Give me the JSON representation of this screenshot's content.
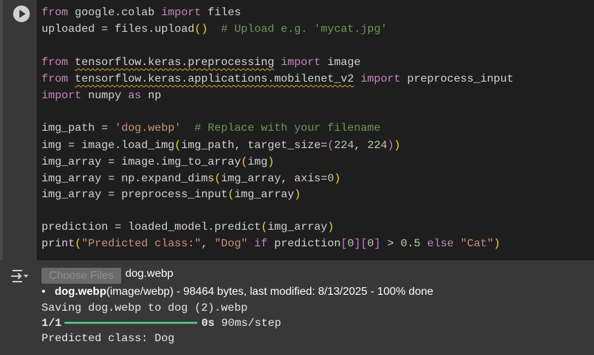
{
  "cell": {
    "run_button": "play-icon",
    "code_lines": [
      [
        [
          "kw",
          "from"
        ],
        [
          "id",
          " google.colab "
        ],
        [
          "kw",
          "import"
        ],
        [
          "id",
          " files"
        ]
      ],
      [
        [
          "id",
          "uploaded = files.upload"
        ],
        [
          "p1",
          "()"
        ],
        [
          "id",
          "  "
        ],
        [
          "cm",
          "# Upload e.g. 'mycat.jpg'"
        ]
      ],
      [],
      [
        [
          "kw",
          "from"
        ],
        [
          "id",
          " "
        ],
        [
          "sq",
          "tensorflow.keras.preprocessing"
        ],
        [
          "id",
          " "
        ],
        [
          "kw",
          "import"
        ],
        [
          "id",
          " image"
        ]
      ],
      [
        [
          "kw",
          "from"
        ],
        [
          "id",
          " "
        ],
        [
          "sq",
          "tensorflow.keras.applications.mobilenet_v2"
        ],
        [
          "id",
          " "
        ],
        [
          "kw",
          "import"
        ],
        [
          "id",
          " preprocess_input"
        ]
      ],
      [
        [
          "kw",
          "import"
        ],
        [
          "id",
          " numpy "
        ],
        [
          "kw",
          "as"
        ],
        [
          "id",
          " np"
        ]
      ],
      [],
      [
        [
          "id",
          "img_path = "
        ],
        [
          "st",
          "'dog.webp'"
        ],
        [
          "id",
          "  "
        ],
        [
          "cm",
          "# Replace with your filename"
        ]
      ],
      [
        [
          "id",
          "img = image.load_img"
        ],
        [
          "p1",
          "("
        ],
        [
          "id",
          "img_path, target_size="
        ],
        [
          "p2",
          "("
        ],
        [
          "nm",
          "224"
        ],
        [
          "id",
          ", "
        ],
        [
          "nm",
          "224"
        ],
        [
          "p2",
          ")"
        ],
        [
          "p1",
          ")"
        ]
      ],
      [
        [
          "id",
          "img_array = image.img_to_array"
        ],
        [
          "p1",
          "("
        ],
        [
          "id",
          "img"
        ],
        [
          "p1",
          ")"
        ]
      ],
      [
        [
          "id",
          "img_array = np.expand_dims"
        ],
        [
          "p1",
          "("
        ],
        [
          "id",
          "img_array, axis="
        ],
        [
          "nm",
          "0"
        ],
        [
          "p1",
          ")"
        ]
      ],
      [
        [
          "id",
          "img_array = preprocess_input"
        ],
        [
          "p1",
          "("
        ],
        [
          "id",
          "img_array"
        ],
        [
          "p1",
          ")"
        ]
      ],
      [],
      [
        [
          "id",
          "prediction = loaded_model.predict"
        ],
        [
          "p1",
          "("
        ],
        [
          "id",
          "img_array"
        ],
        [
          "p1",
          ")"
        ]
      ],
      [
        [
          "id",
          "print"
        ],
        [
          "p1",
          "("
        ],
        [
          "st",
          "\"Predicted class:\""
        ],
        [
          "id",
          ", "
        ],
        [
          "st",
          "\"Dog\""
        ],
        [
          "id",
          " "
        ],
        [
          "kw",
          "if"
        ],
        [
          "id",
          " prediction"
        ],
        [
          "p2",
          "["
        ],
        [
          "nm",
          "0"
        ],
        [
          "p2",
          "]["
        ],
        [
          "nm",
          "0"
        ],
        [
          "p2",
          "]"
        ],
        [
          "id",
          " > "
        ],
        [
          "nm",
          "0.5"
        ],
        [
          "id",
          " "
        ],
        [
          "kw",
          "else"
        ],
        [
          "id",
          " "
        ],
        [
          "st",
          "\"Cat\""
        ],
        [
          "p1",
          ")"
        ]
      ]
    ]
  },
  "output": {
    "icon": "output-toggle-icon",
    "choose_files_label": "Choose Files",
    "chosen_file": "dog.webp",
    "file_name": "dog.webp",
    "file_details": "(image/webp) - 98464 bytes, last modified: 8/13/2025 - 100% done",
    "saving_line": "Saving dog.webp to dog (2).webp",
    "progress_step": "1/1",
    "progress_percent": 100,
    "progress_time": "0s",
    "progress_rate": "90ms/step",
    "result_line": "Predicted class: Dog"
  }
}
